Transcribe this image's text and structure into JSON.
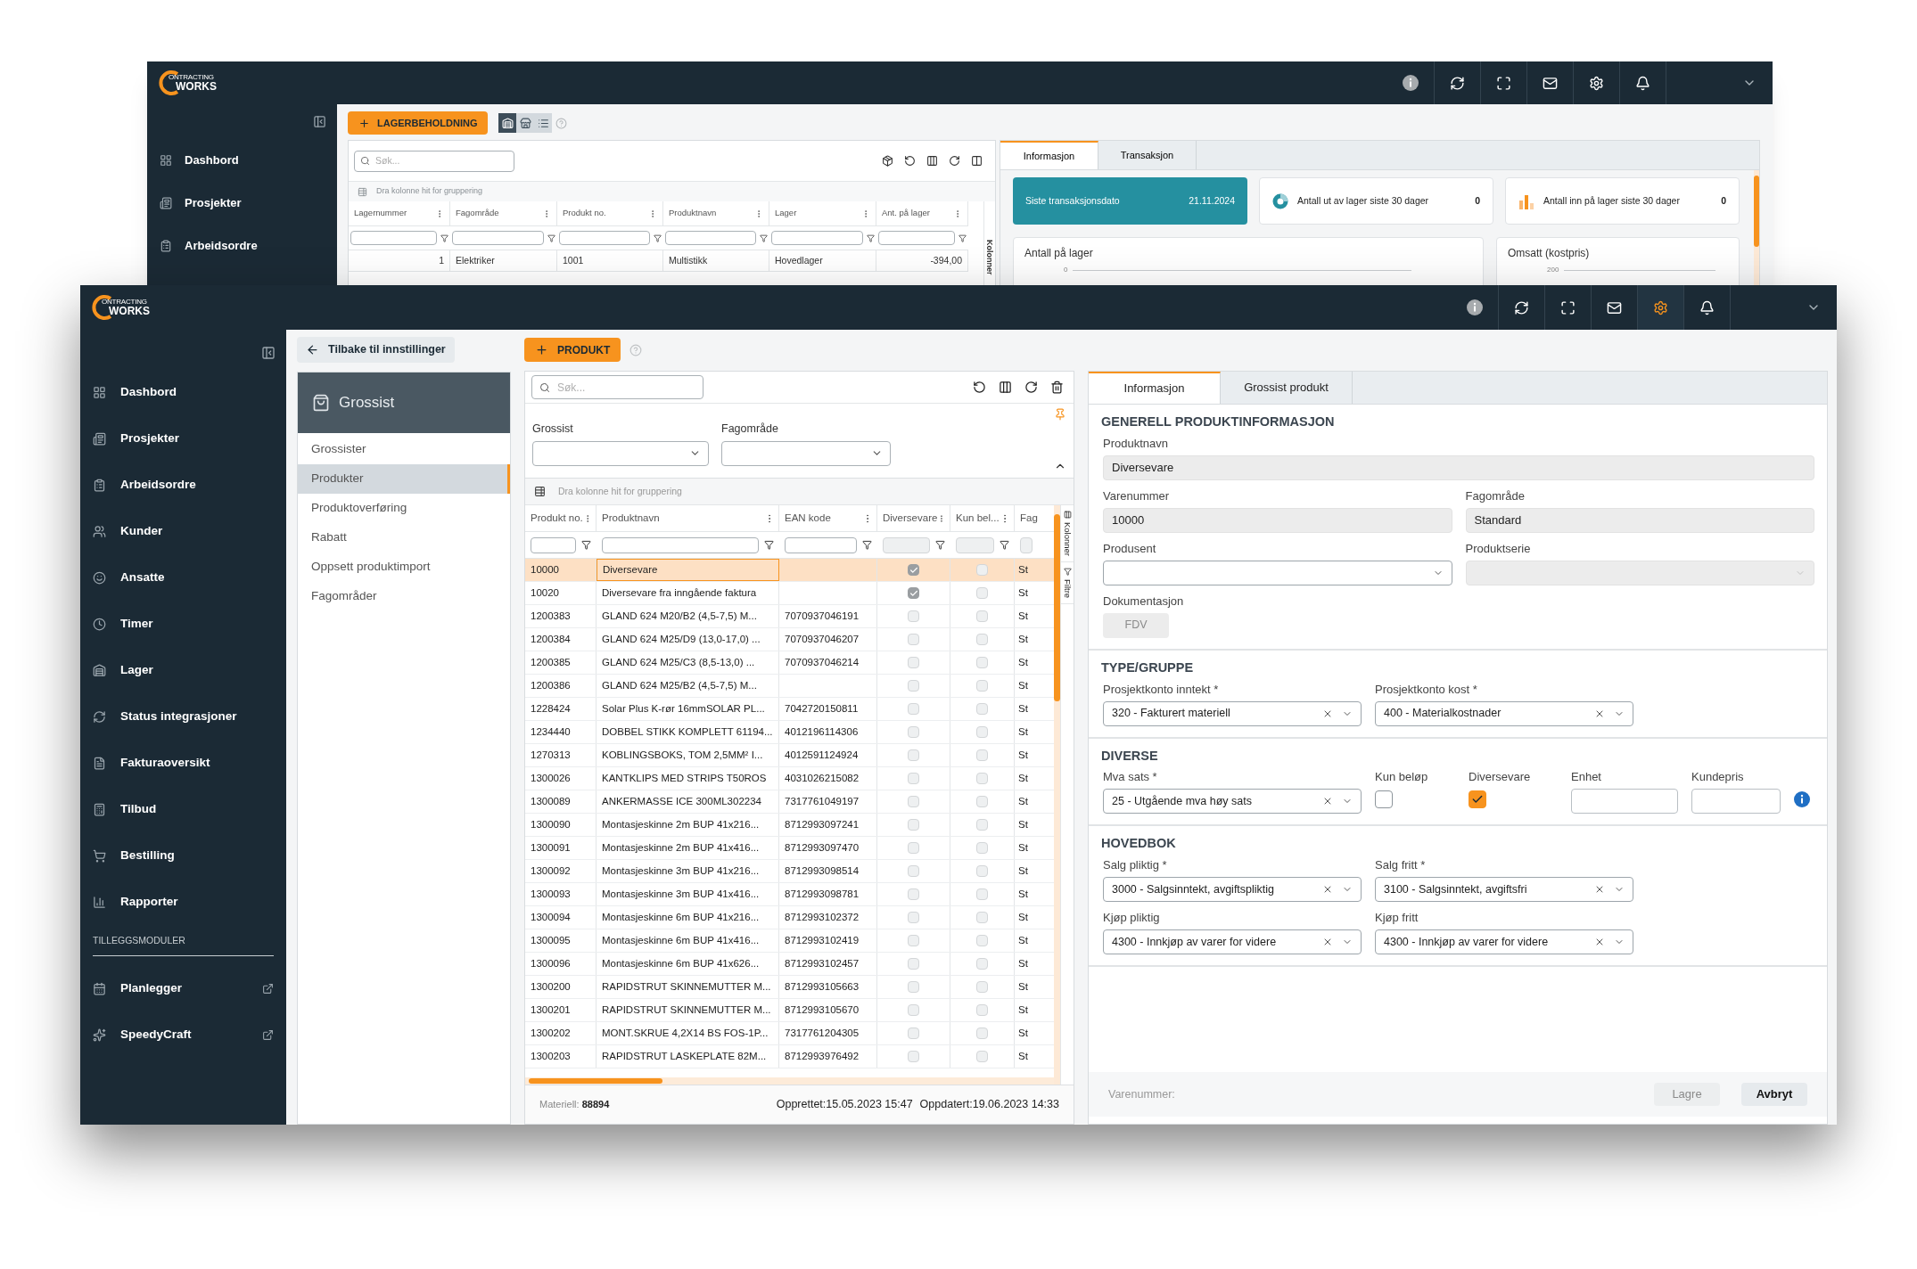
{
  "back_window": {
    "logo": [
      "ONTRACTING",
      "WORKS"
    ],
    "header_icons": [
      {
        "selected": false
      },
      {
        "selected": false
      },
      {
        "selected": false
      },
      {
        "selected": false
      },
      {
        "selected": false
      },
      {
        "selected": false
      }
    ],
    "sidebar": [
      "Dashbord",
      "Prosjekter",
      "Arbeidsordre"
    ],
    "add_button": "LAGERBEHOLDNING",
    "view_toggles": [
      {
        "selected": true
      },
      {
        "selected": false
      },
      {
        "selected": false
      }
    ],
    "search_placeholder": "Søk...",
    "group_hint": "Dra kolonne hit for gruppering",
    "columns": [
      "Lagernummer",
      "Fagområde",
      "Produkt no.",
      "Produktnavn",
      "Lager",
      "Ant. på lager"
    ],
    "rows": [
      [
        "1",
        "Elektriker",
        "1001",
        "Multistikk",
        "Hovedlager",
        "-394,00"
      ]
    ],
    "side_tab": "Kolonner",
    "tabs": [
      {
        "label": "Informasjon",
        "selected": true
      },
      {
        "label": "Transaksjon",
        "selected": false
      }
    ],
    "stat_cards": [
      {
        "kind": "highlight",
        "label": "Siste transaksjonsdato",
        "value": "21.11.2024"
      },
      {
        "kind": "donut",
        "label": "Antall ut av lager siste 30 dager",
        "value": "0"
      },
      {
        "kind": "bars",
        "label": "Antall inn på lager siste 30 dager",
        "value": "0"
      }
    ],
    "chart_cards": [
      {
        "title": "Antall på lager",
        "tick": "0"
      },
      {
        "title": "Omsatt (kostpris)",
        "tick": "200"
      }
    ]
  },
  "window": {
    "logo": [
      "ONTRACTING",
      "WORKS"
    ],
    "header_icons": [
      {
        "selected": false
      },
      {
        "selected": false
      },
      {
        "selected": false
      },
      {
        "selected": false
      },
      {
        "selected": true
      },
      {
        "selected": false
      }
    ],
    "sidebar": {
      "items": [
        "Dashbord",
        "Prosjekter",
        "Arbeidsordre",
        "Kunder",
        "Ansatte",
        "Timer",
        "Lager",
        "Status integrasjoner",
        "Fakturaoversikt",
        "Tilbud",
        "Bestilling",
        "Rapporter"
      ],
      "section": "TILLEGGSMODULER",
      "modules": [
        "Planlegger",
        "SpeedyCraft"
      ]
    },
    "back_link": "Tilbake til innstillinger",
    "settings_nav": {
      "title": "Grossist",
      "items": [
        {
          "label": "Grossister",
          "selected": false
        },
        {
          "label": "Produkter",
          "selected": true
        },
        {
          "label": "Produktoverføring",
          "selected": false
        },
        {
          "label": "Rabatt",
          "selected": false
        },
        {
          "label": "Oppsett produktimport",
          "selected": false
        },
        {
          "label": "Fagområder",
          "selected": false
        }
      ]
    },
    "grid": {
      "add_button": "PRODUKT",
      "search_placeholder": "Søk...",
      "filters": [
        "Grossist",
        "Fagområde"
      ],
      "group_hint": "Dra kolonne hit for gruppering",
      "columns": [
        {
          "label": "Produkt no.",
          "kind": "text"
        },
        {
          "label": "Produktnavn",
          "kind": "text"
        },
        {
          "label": "EAN kode",
          "kind": "text"
        },
        {
          "label": "Diversevare",
          "kind": "bool"
        },
        {
          "label": "Kun bel...",
          "kind": "bool"
        },
        {
          "label": "Fag",
          "kind": "cut"
        }
      ],
      "rows": [
        {
          "no": "10000",
          "name": "Diversevare",
          "diversevare": true,
          "kun_belop": false,
          "column_6": "St",
          "selected": true
        },
        {
          "no": "10020",
          "name": "Diversevare fra inngående faktura",
          "diversevare": true,
          "kun_belop": false,
          "column_6": "St",
          "selected": false
        },
        {
          "no": "1200383",
          "name": "GLAND 624 M20/B2 (4,5-7,5) M...",
          "ean": "7070937046191",
          "diversevare": false,
          "kun_belop": false,
          "column_6": "St",
          "selected": false
        },
        {
          "no": "1200384",
          "name": "GLAND 624 M25/D9 (13,0-17,0) ...",
          "ean": "7070937046207",
          "diversevare": false,
          "kun_belop": false,
          "column_6": "St",
          "selected": false
        },
        {
          "no": "1200385",
          "name": "GLAND 624 M25/C3 (8,5-13,0) ...",
          "ean": "7070937046214",
          "diversevare": false,
          "kun_belop": false,
          "column_6": "St",
          "selected": false
        },
        {
          "no": "1200386",
          "name": "GLAND 624 M25/B2 (4,5-7,5) M...",
          "diversevare": false,
          "kun_belop": false,
          "column_6": "St",
          "selected": false
        },
        {
          "no": "1228424",
          "name": "Solar Plus K-rør 16mmSOLAR PL...",
          "ean": "7042720150811",
          "diversevare": false,
          "kun_belop": false,
          "column_6": "St",
          "selected": false
        },
        {
          "no": "1234440",
          "name": "DOBBEL STIKK KOMPLETT 61194...",
          "ean": "4012196114306",
          "diversevare": false,
          "kun_belop": false,
          "column_6": "St",
          "selected": false
        },
        {
          "no": "1270313",
          "name": "KOBLINGSBOKS, TOM 2,5MM² I...",
          "ean": "4012591124924",
          "diversevare": false,
          "kun_belop": false,
          "column_6": "St",
          "selected": false
        },
        {
          "no": "1300026",
          "name": "KANTKLIPS MED STRIPS T50ROS",
          "ean": "4031026215082",
          "diversevare": false,
          "kun_belop": false,
          "column_6": "St",
          "selected": false
        },
        {
          "no": "1300089",
          "name": "ANKERMASSE ICE 300ML302234",
          "ean": "7317761049197",
          "diversevare": false,
          "kun_belop": false,
          "column_6": "St",
          "selected": false
        },
        {
          "no": "1300090",
          "name": "Montasjeskinne 2m BUP 41x216...",
          "ean": "8712993097241",
          "diversevare": false,
          "kun_belop": false,
          "column_6": "St",
          "selected": false
        },
        {
          "no": "1300091",
          "name": "Montasjeskinne 2m BUP 41x416...",
          "ean": "8712993097470",
          "diversevare": false,
          "kun_belop": false,
          "column_6": "St",
          "selected": false
        },
        {
          "no": "1300092",
          "name": "Montasjeskinne 3m BUP 41x216...",
          "ean": "8712993098514",
          "diversevare": false,
          "kun_belop": false,
          "column_6": "St",
          "selected": false
        },
        {
          "no": "1300093",
          "name": "Montasjeskinne 3m BUP 41x416...",
          "ean": "8712993098781",
          "diversevare": false,
          "kun_belop": false,
          "column_6": "St",
          "selected": false
        },
        {
          "no": "1300094",
          "name": "Montasjeskinne 6m BUP 41x216...",
          "ean": "8712993102372",
          "diversevare": false,
          "kun_belop": false,
          "column_6": "St",
          "selected": false
        },
        {
          "no": "1300095",
          "name": "Montasjeskinne 6m BUP 41x416...",
          "ean": "8712993102419",
          "diversevare": false,
          "kun_belop": false,
          "column_6": "St",
          "selected": false
        },
        {
          "no": "1300096",
          "name": "Montasjeskinne 6m BUP 41x626...",
          "ean": "8712993102457",
          "diversevare": false,
          "kun_belop": false,
          "column_6": "St",
          "selected": false
        },
        {
          "no": "1300200",
          "name": "RAPIDSTRUT SKINNEMUTTER M...",
          "ean": "8712993105663",
          "diversevare": false,
          "kun_belop": false,
          "column_6": "St",
          "selected": false
        },
        {
          "no": "1300201",
          "name": "RAPIDSTRUT SKINNEMUTTER M...",
          "ean": "8712993105670",
          "diversevare": false,
          "kun_belop": false,
          "column_6": "St",
          "selected": false
        },
        {
          "no": "1300202",
          "name": "MONT.SKRUE 4,2X14 BS FOS-1P...",
          "ean": "7317761204305",
          "diversevare": false,
          "kun_belop": false,
          "column_6": "St",
          "selected": false
        },
        {
          "no": "1300203",
          "name": "RAPIDSTRUT LASKEPLATE 82M...",
          "ean": "8712993976492",
          "diversevare": false,
          "kun_belop": false,
          "column_6": "St",
          "selected": false
        }
      ],
      "side_tabs": [
        "Kolonner",
        "Filtre"
      ],
      "footer": {
        "count_label": "Materiell:",
        "count": "88894",
        "created": "Opprettet:15.05.2023 15:47",
        "updated": "Oppdatert:19.06.2023 14:33"
      }
    },
    "detail": {
      "tabs": [
        {
          "label": "Informasjon",
          "selected": true
        },
        {
          "label": "Grossist produkt",
          "selected": false
        }
      ],
      "sections": [
        {
          "kind": "general",
          "title": "GENERELL PRODUKTINFORMASJON",
          "fields": [
            {
              "kind": "text",
              "label": "Produktnavn",
              "value": "Diversevare",
              "disabled": true
            },
            {
              "kind": "text",
              "label": "Varenummer",
              "value": "10000",
              "disabled": true
            },
            {
              "kind": "text",
              "label": "Fagområde",
              "value": "Standard",
              "disabled": true
            },
            {
              "kind": "select",
              "label": "Produsent",
              "disabled": false
            },
            {
              "kind": "select",
              "label": "Produktserie",
              "disabled": true
            },
            {
              "kind": "button",
              "label": "Dokumentasjon",
              "value": "FDV",
              "disabled": true
            }
          ]
        },
        {
          "kind": "pairs",
          "title": "TYPE/GRUPPE",
          "fields": [
            {
              "kind": "select",
              "label": "Prosjektkonto inntekt *",
              "value": "320 - Fakturert materiell",
              "disabled": false,
              "clearable": true
            },
            {
              "kind": "select",
              "label": "Prosjektkonto kost *",
              "value": "400 - Materialkostnader",
              "disabled": false,
              "clearable": true
            }
          ]
        },
        {
          "kind": "diverse",
          "title": "DIVERSE",
          "fields": [
            {
              "kind": "select",
              "label": "Mva sats *",
              "value": "25 - Utgående mva høy sats",
              "disabled": false,
              "clearable": true
            },
            {
              "kind": "checkbox",
              "label": "Kun beløp",
              "checked": false
            },
            {
              "kind": "checkbox",
              "label": "Diversevare",
              "checked": true
            },
            {
              "kind": "text",
              "label": "Enhet",
              "disabled": false
            },
            {
              "kind": "text",
              "label": "Kundepris",
              "disabled": false
            }
          ]
        },
        {
          "kind": "pairs",
          "title": "HOVEDBOK",
          "fields": [
            {
              "kind": "select",
              "label": "Salg pliktig *",
              "value": "3000 - Salgsinntekt, avgiftspliktig",
              "disabled": false,
              "clearable": true
            },
            {
              "kind": "select",
              "label": "Salg fritt *",
              "value": "3100 - Salgsinntekt, avgiftsfri",
              "disabled": false,
              "clearable": true
            },
            {
              "kind": "select",
              "label": "Kjøp pliktig",
              "value": "4300 - Innkjøp av varer for videre",
              "disabled": false,
              "clearable": true
            },
            {
              "kind": "select",
              "label": "Kjøp fritt",
              "value": "4300 - Innkjøp av varer for videre",
              "disabled": false,
              "clearable": true
            }
          ]
        }
      ],
      "footer": {
        "label": "Varenummer:",
        "buttons": [
          {
            "label": "Lagre",
            "disabled": true
          },
          {
            "label": "Avbryt",
            "disabled": false
          }
        ]
      }
    }
  }
}
